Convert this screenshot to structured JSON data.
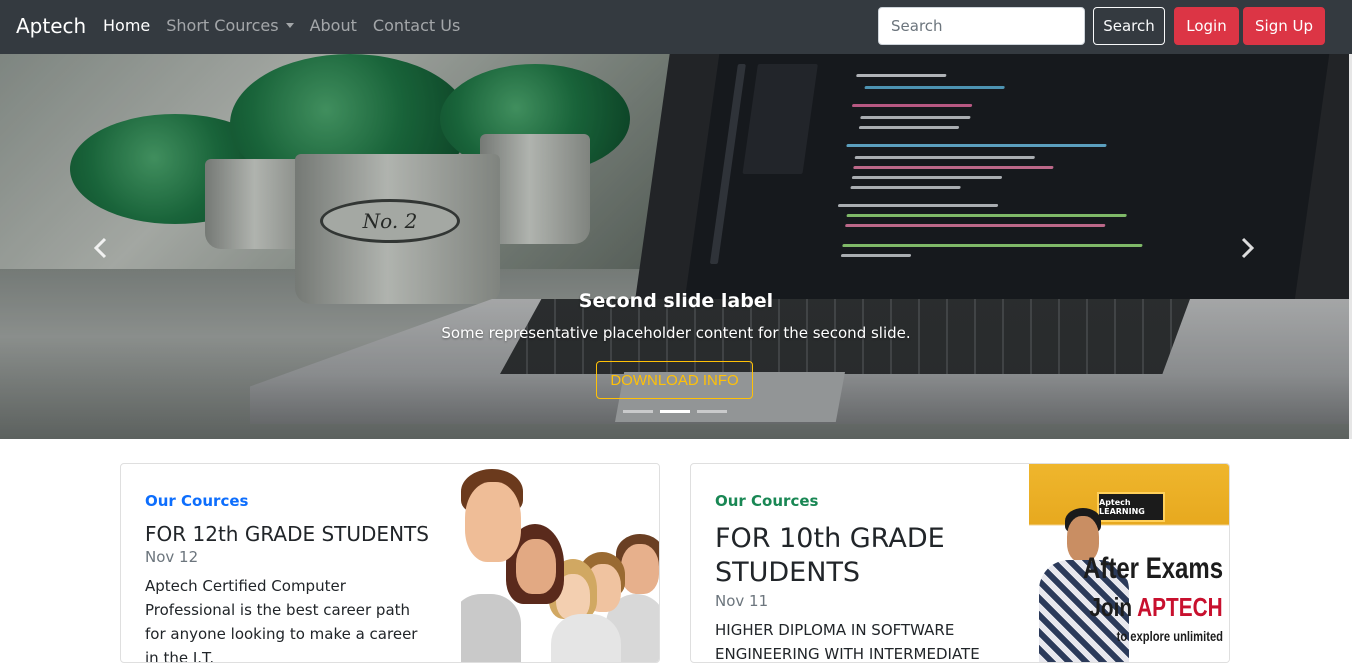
{
  "navbar": {
    "brand": "Aptech",
    "links": [
      {
        "label": "Home",
        "active": true
      },
      {
        "label": "Short Cources",
        "dropdown": true
      },
      {
        "label": "About"
      },
      {
        "label": "Contact Us"
      }
    ],
    "search_placeholder": "Search",
    "search_button": "Search",
    "login_button": "Login",
    "signup_button": "Sign Up"
  },
  "carousel": {
    "caption_title": "Second slide label",
    "caption_text": "Some representative placeholder content for the second slide.",
    "button_label": "DOWNLOAD INFO",
    "image_text": "No. 2",
    "indicators": 3,
    "active_indicator": 1,
    "prev_icon": "chevron-left-icon",
    "next_icon": "chevron-right-icon"
  },
  "cards": [
    {
      "category": "Our Cources",
      "title": "FOR 12th GRADE STUDENTS",
      "date": "Nov 12",
      "text": "Aptech Certified Computer Professional is the best career path for anyone looking to make a career in the I.T."
    },
    {
      "category": "Our Cources",
      "title": "FOR 10th GRADE STUDENTS",
      "date": "Nov 11",
      "text": "HIGHER DIPLOMA IN SOFTWARE ENGINEERING WITH INTERMEDIATE",
      "ad": {
        "logo": "Aptech LEARNING",
        "line1": "After Exams",
        "line2_a": "Join ",
        "line2_b": "APTECH",
        "line3": "to explore unlimited"
      }
    }
  ],
  "colors": {
    "navbar_bg": "#343a40",
    "danger": "#dc3545",
    "warning": "#ffc107",
    "primary": "#0d6efd",
    "success": "#198754"
  }
}
